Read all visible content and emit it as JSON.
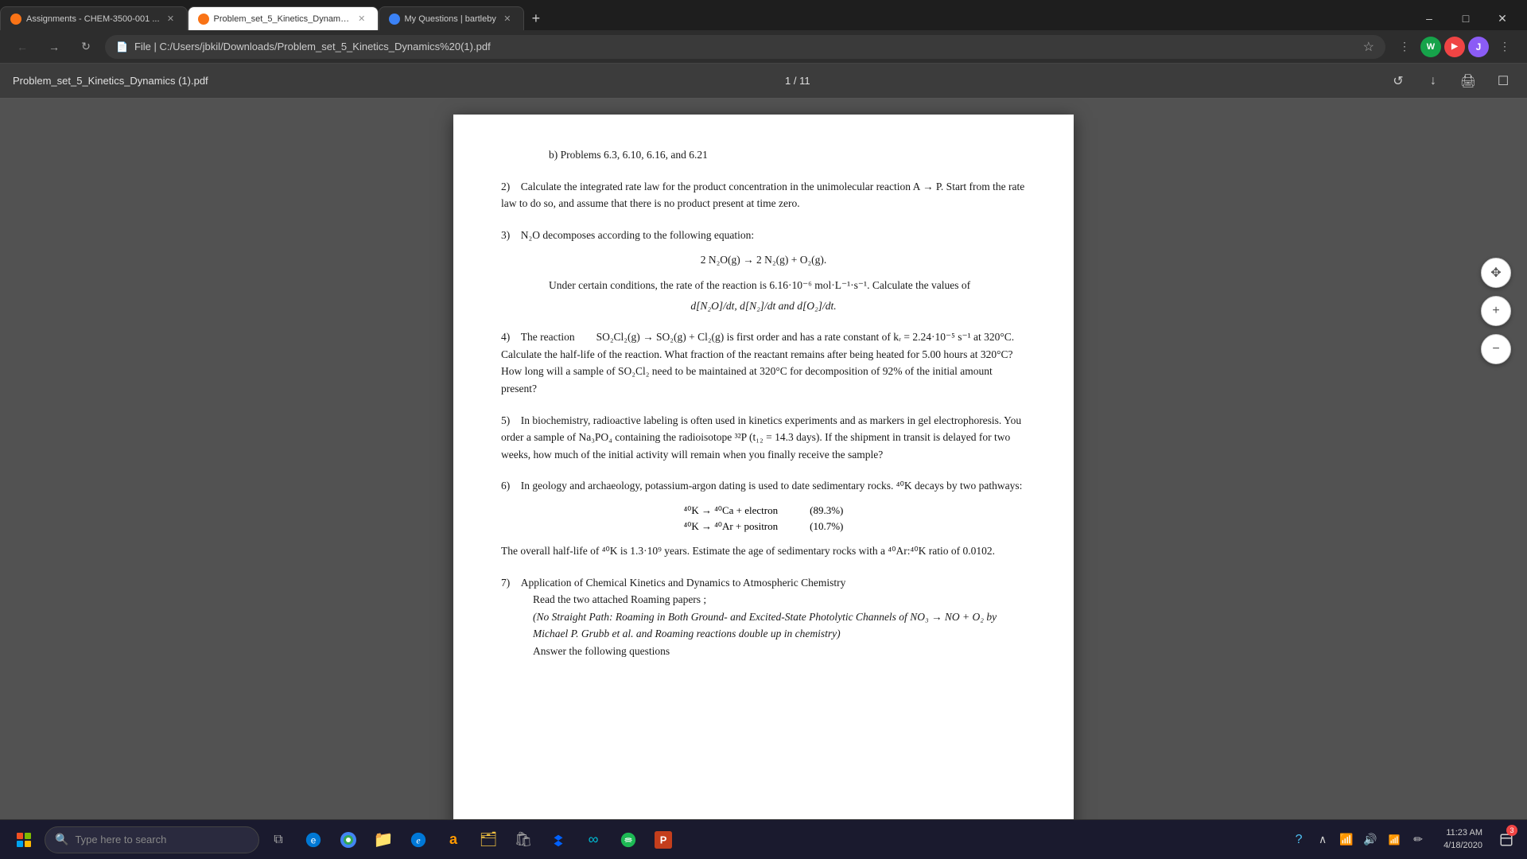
{
  "browser": {
    "tabs": [
      {
        "id": "tab1",
        "label": "Assignments - CHEM-3500-001 ...",
        "favicon": "orange",
        "active": false
      },
      {
        "id": "tab2",
        "label": "Problem_set_5_Kinetics_Dynamic...",
        "favicon": "orange",
        "active": true
      },
      {
        "id": "tab3",
        "label": "My Questions | bartleby",
        "favicon": "blue",
        "active": false
      }
    ],
    "url": "File  |  C:/Users/jbkil/Downloads/Problem_set_5_Kinetics_Dynamics%20(1).pdf"
  },
  "pdf": {
    "title": "Problem_set_5_Kinetics_Dynamics (1).pdf",
    "page": "1 / 11",
    "content": {
      "item_b": "b) Problems 6.3, 6.10, 6.16, and 6.21",
      "item2": "2) Calculate the integrated rate law for the product concentration in the unimolecular reaction A → P. Start from the rate law to do so, and assume that there is no product present at time zero.",
      "item3_intro": "3) N₂O decomposes according to the following equation:",
      "item3_eq": "2 N₂O(g) → 2 N₂(g) + O₂(g).",
      "item3_cond": "Under certain conditions, the rate of the reaction is 6.16·10⁻⁶ mol·L⁻¹·s⁻¹. Calculate the values of",
      "item3_deriv": "d[N₂O]/dt, d[N₂]/dt and d[O₂]/dt.",
      "item4": "4) The reaction  SO₂Cl₂(g) → SO₂(g) + Cl₂(g) is first order and has a rate constant of kᵣ = 2.24·10⁻⁵ s⁻¹ at 320°C. Calculate the half-life of the reaction. What fraction of the reactant remains after being heated for 5.00 hours at 320°C? How long will a sample of SO₂Cl₂ need to be maintained at 320°C for decomposition of 92% of the initial amount present?",
      "item5": "5) In biochemistry, radioactive labeling is often used in kinetics experiments and as markers in gel electrophoresis. You order a sample of Na₃PO₄ containing the radioisotope ³²P (t₁₂ = 14.3 days). If the shipment in transit is delayed for two weeks, how much of the initial activity will remain when you finally receive the sample?",
      "item6_intro": "6) In geology and archaeology, potassium-argon dating is used to date sedimentary rocks. ⁴⁰K decays by two pathways:",
      "item6_r1_eq": "⁴⁰K → ⁴⁰Ca + electron",
      "item6_r1_pct": "(89.3%)",
      "item6_r2_eq": "⁴⁰K → ⁴⁰Ar + positron",
      "item6_r2_pct": "(10.7%)",
      "item6_cont": "The overall half-life of ⁴⁰K is 1.3·10⁹ years. Estimate the age of sedimentary rocks with a ⁴⁰Ar:⁴⁰K ratio of 0.0102.",
      "item7_title": "7) Application of Chemical Kinetics and Dynamics to Atmospheric Chemistry",
      "item7_read": "Read the two attached Roaming papers ;",
      "item7_papers": "(No Straight Path: Roaming in Both Ground- and Excited-State Photolytic Channels of NO₃ → NO + O₂ by  Michael P. Grubb et al. and  Roaming reactions double up in chemistry)",
      "item7_answer": "Answer the following questions"
    }
  },
  "taskbar": {
    "search_placeholder": "Type here to search",
    "clock": {
      "time": "11:23 AM",
      "date": "4/18/2020"
    },
    "icons": [
      "edge",
      "chrome",
      "file-explorer",
      "amazon",
      "dropbox",
      "spotify",
      "powerpoint"
    ]
  }
}
